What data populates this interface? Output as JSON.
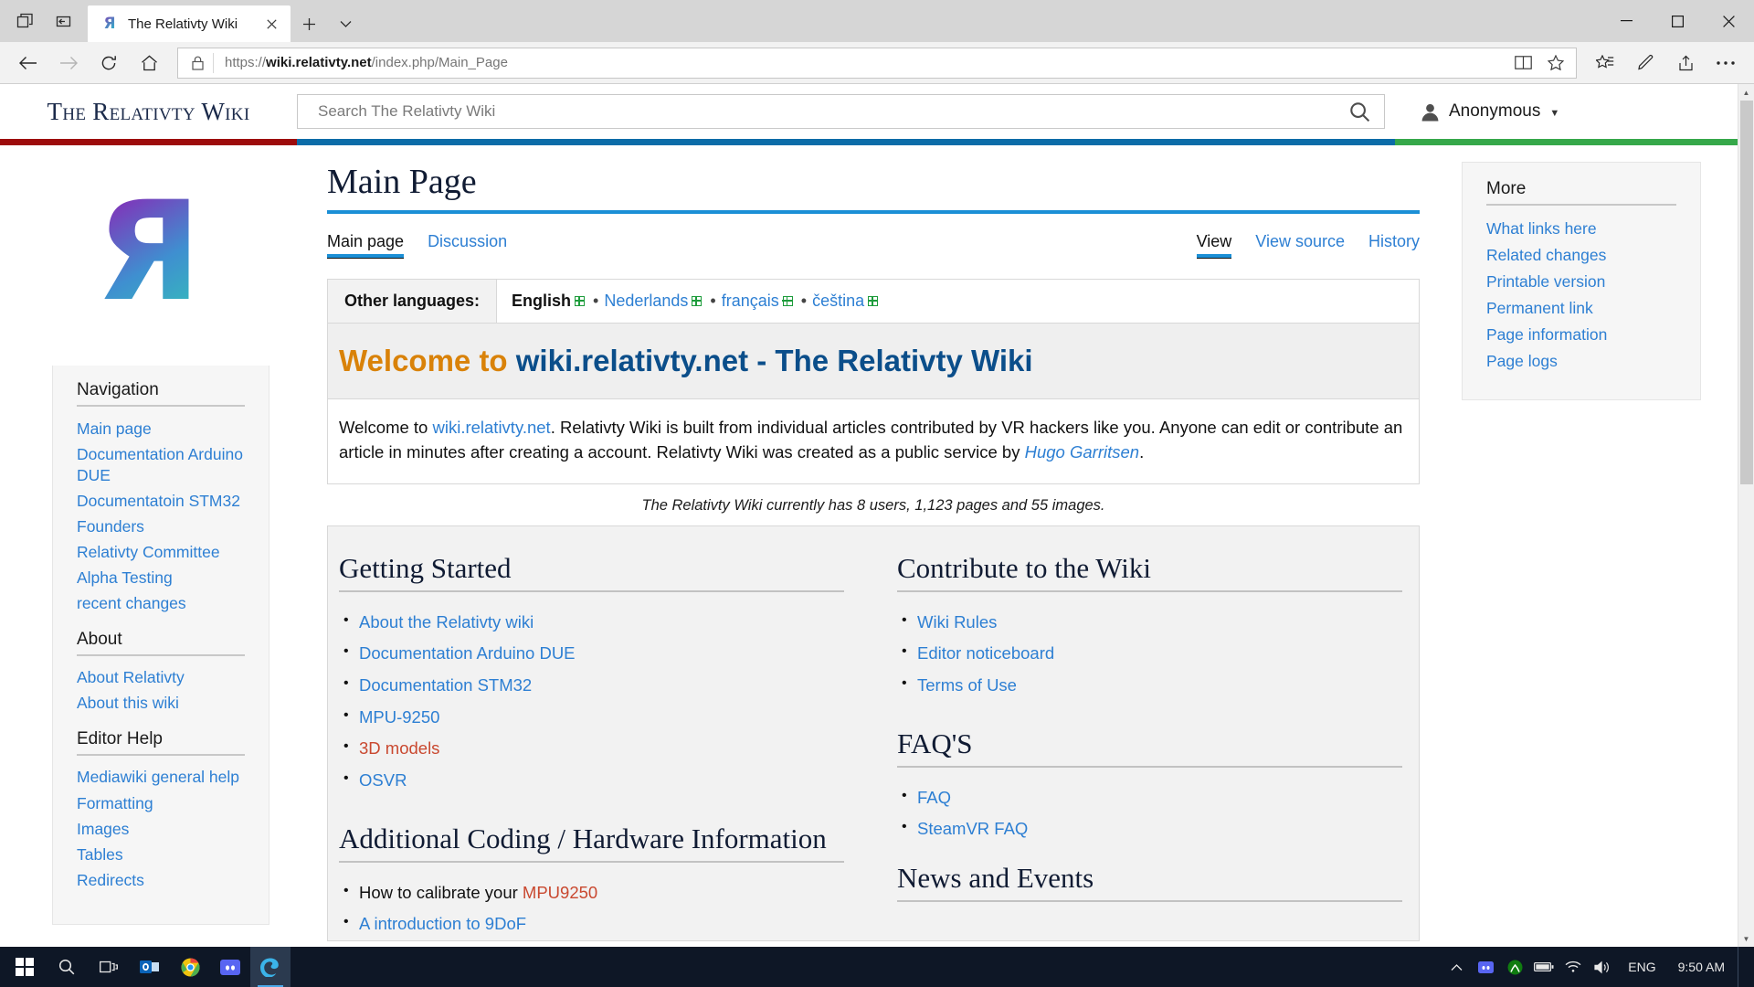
{
  "browser": {
    "tab": {
      "title": "The Relativty Wiki",
      "favicon_icon": "relativty-logo-icon",
      "close_icon": "close-icon"
    },
    "new_tab_icon": "plus-icon",
    "tab_menu_icon": "chevron-down-icon",
    "task_view_icon": "task-view-icon",
    "set_aside_icon": "set-tabs-aside-icon",
    "window": {
      "minimize": "minimize-icon",
      "maximize": "maximize-icon",
      "close": "close-icon"
    },
    "nav": {
      "back_icon": "arrow-left-icon",
      "forward_icon": "arrow-right-icon",
      "refresh_icon": "refresh-icon",
      "home_icon": "home-icon",
      "lock_icon": "lock-icon",
      "url_prefix": "https://",
      "url_host": "wiki.relativty.net",
      "url_path": "/index.php/Main_Page",
      "url_full": "https://wiki.relativty.net/index.php/Main_Page",
      "reading_view_icon": "reading-view-icon",
      "favorite_icon": "star-icon",
      "favorites_hub_icon": "favorites-hub-icon",
      "web_note_icon": "web-note-icon",
      "share_icon": "share-icon",
      "settings_icon": "more-ellipsis-icon"
    }
  },
  "wiki": {
    "brand": "The Relativty Wiki",
    "logo_letter": "Я",
    "search": {
      "placeholder": "Search The Relativty Wiki",
      "value": "",
      "icon": "search-icon"
    },
    "user": {
      "name": "Anonymous",
      "avatar_icon": "user-avatar-icon",
      "caret_icon": "chevron-down-icon"
    },
    "colors": {
      "red": "#9d0b0b",
      "blue": "#0b6ca8",
      "green": "#36a84a",
      "link": "#2d7fd3",
      "redlink": "#c9482f",
      "accent_orange": "#d98209"
    }
  },
  "sidebar": {
    "sections": [
      {
        "heading": "Navigation",
        "links": [
          "Main page",
          "Documentation Arduino DUE",
          "Documentatoin STM32",
          "Founders",
          "Relativty Committee",
          "Alpha Testing",
          "recent changes"
        ]
      },
      {
        "heading": "About",
        "links": [
          "About Relativty",
          "About this wiki"
        ]
      },
      {
        "heading": "Editor Help",
        "links": [
          "Mediawiki general help",
          "Formatting",
          "Images",
          "Tables",
          "Redirects"
        ]
      }
    ]
  },
  "main": {
    "title": "Main Page",
    "page_tabs": [
      {
        "label": "Main page",
        "active": true
      },
      {
        "label": "Discussion",
        "active": false
      }
    ],
    "view_tabs": [
      {
        "label": "View",
        "active": true
      },
      {
        "label": "View source",
        "active": false
      },
      {
        "label": "History",
        "active": false
      }
    ],
    "languages": {
      "label": "Other languages:",
      "items": [
        {
          "name": "English",
          "current": true
        },
        {
          "name": "Nederlands",
          "current": false
        },
        {
          "name": "français",
          "current": false
        },
        {
          "name": "čeština",
          "current": false
        }
      ],
      "separator": "•",
      "external_icon": "external-link-icon"
    },
    "welcome": {
      "lead": "Welcome to ",
      "site": "wiki.relativty.net",
      "tail": " - The Relativty Wiki"
    },
    "intro": {
      "p1": "Welcome to ",
      "link1": "wiki.relativty.net",
      "p2": ". Relativty Wiki is built from individual articles contributed by VR hackers like you. Anyone can edit or contribute an article in minutes after creating a account. Relativty Wiki was created as a public service by ",
      "link2": "Hugo Garritsen",
      "p3": "."
    },
    "stats": "The Relativty Wiki currently has 8 users, 1,123 pages and 55 images.",
    "columns": {
      "left": [
        {
          "heading": "Getting Started",
          "items": [
            {
              "text": "About the Relativty wiki",
              "style": "link"
            },
            {
              "text": "Documentation Arduino DUE",
              "style": "link"
            },
            {
              "text": "Documentation STM32",
              "style": "link"
            },
            {
              "text": "MPU-9250",
              "style": "link"
            },
            {
              "text": "3D models",
              "style": "redlink"
            },
            {
              "text": "OSVR",
              "style": "link"
            }
          ]
        },
        {
          "heading": "Additional Coding / Hardware Information",
          "items": [
            {
              "text": "How to calibrate your ",
              "style": "plain",
              "suffix": "MPU9250",
              "suffix_style": "redlink"
            },
            {
              "text": "A introduction to 9DoF",
              "style": "link"
            }
          ]
        }
      ],
      "right": [
        {
          "heading": "Contribute to the Wiki",
          "items": [
            {
              "text": "Wiki Rules",
              "style": "link"
            },
            {
              "text": "Editor noticeboard",
              "style": "link"
            },
            {
              "text": "Terms of Use",
              "style": "link"
            }
          ]
        },
        {
          "heading": "FAQ'S",
          "items": [
            {
              "text": "FAQ",
              "style": "link"
            },
            {
              "text": "SteamVR FAQ",
              "style": "link"
            }
          ]
        },
        {
          "heading": "News and Events",
          "items": []
        }
      ]
    }
  },
  "rail": {
    "heading": "More",
    "links": [
      "What links here",
      "Related changes",
      "Printable version",
      "Permanent link",
      "Page information",
      "Page logs"
    ]
  },
  "taskbar": {
    "start_icon": "windows-start-icon",
    "search_icon": "search-icon",
    "task_view_icon": "task-view-icon",
    "apps": [
      {
        "name": "outlook-icon"
      },
      {
        "name": "chrome-icon"
      },
      {
        "name": "discord-icon"
      },
      {
        "name": "edge-icon",
        "active": true
      }
    ],
    "tray": {
      "chevron_icon": "show-hidden-icons-icon",
      "icons": [
        "discord-tray-icon",
        "xbox-tray-icon",
        "battery-icon",
        "wifi-icon",
        "volume-icon"
      ],
      "language": "ENG",
      "time": "9:50 AM",
      "show_desktop_icon": "show-desktop-icon"
    }
  }
}
